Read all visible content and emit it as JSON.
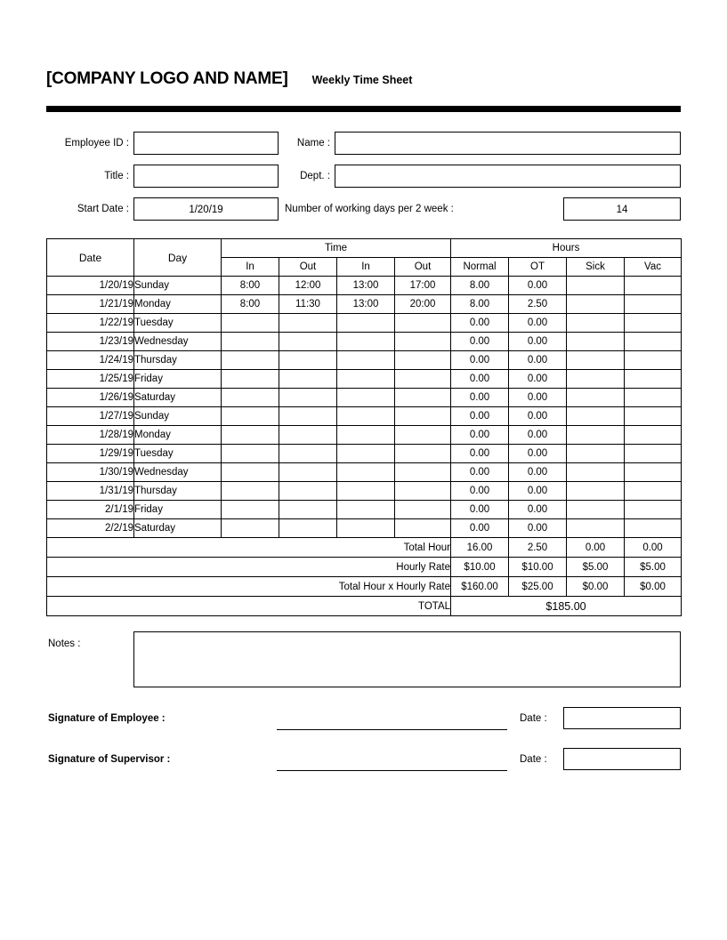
{
  "header": {
    "company": "[COMPANY LOGO AND NAME]",
    "doc_title": "Weekly Time Sheet"
  },
  "form": {
    "employee_id_label": "Employee ID :",
    "employee_id_value": "",
    "name_label": "Name :",
    "name_value": "",
    "title_label": "Title :",
    "title_value": "",
    "dept_label": "Dept. :",
    "dept_value": "",
    "start_date_label": "Start Date :",
    "start_date_value": "1/20/19",
    "working_days_label": "Number of working days per 2 week :",
    "working_days_value": "14"
  },
  "table": {
    "group_headers": {
      "date": "Date",
      "day": "Day",
      "time": "Time",
      "hours": "Hours"
    },
    "sub_headers": {
      "time_in_1": "In",
      "time_out_1": "Out",
      "time_in_2": "In",
      "time_out_2": "Out",
      "normal": "Normal",
      "ot": "OT",
      "sick": "Sick",
      "vac": "Vac"
    },
    "rows": [
      {
        "date": "1/20/19",
        "day": "Sunday",
        "in1": "8:00",
        "out1": "12:00",
        "in2": "13:00",
        "out2": "17:00",
        "normal": "8.00",
        "ot": "0.00",
        "sick": "",
        "vac": ""
      },
      {
        "date": "1/21/19",
        "day": "Monday",
        "in1": "8:00",
        "out1": "11:30",
        "in2": "13:00",
        "out2": "20:00",
        "normal": "8.00",
        "ot": "2.50",
        "sick": "",
        "vac": ""
      },
      {
        "date": "1/22/19",
        "day": "Tuesday",
        "in1": "",
        "out1": "",
        "in2": "",
        "out2": "",
        "normal": "0.00",
        "ot": "0.00",
        "sick": "",
        "vac": ""
      },
      {
        "date": "1/23/19",
        "day": "Wednesday",
        "in1": "",
        "out1": "",
        "in2": "",
        "out2": "",
        "normal": "0.00",
        "ot": "0.00",
        "sick": "",
        "vac": ""
      },
      {
        "date": "1/24/19",
        "day": "Thursday",
        "in1": "",
        "out1": "",
        "in2": "",
        "out2": "",
        "normal": "0.00",
        "ot": "0.00",
        "sick": "",
        "vac": ""
      },
      {
        "date": "1/25/19",
        "day": "Friday",
        "in1": "",
        "out1": "",
        "in2": "",
        "out2": "",
        "normal": "0.00",
        "ot": "0.00",
        "sick": "",
        "vac": ""
      },
      {
        "date": "1/26/19",
        "day": "Saturday",
        "in1": "",
        "out1": "",
        "in2": "",
        "out2": "",
        "normal": "0.00",
        "ot": "0.00",
        "sick": "",
        "vac": ""
      },
      {
        "date": "1/27/19",
        "day": "Sunday",
        "in1": "",
        "out1": "",
        "in2": "",
        "out2": "",
        "normal": "0.00",
        "ot": "0.00",
        "sick": "",
        "vac": ""
      },
      {
        "date": "1/28/19",
        "day": "Monday",
        "in1": "",
        "out1": "",
        "in2": "",
        "out2": "",
        "normal": "0.00",
        "ot": "0.00",
        "sick": "",
        "vac": ""
      },
      {
        "date": "1/29/19",
        "day": "Tuesday",
        "in1": "",
        "out1": "",
        "in2": "",
        "out2": "",
        "normal": "0.00",
        "ot": "0.00",
        "sick": "",
        "vac": ""
      },
      {
        "date": "1/30/19",
        "day": "Wednesday",
        "in1": "",
        "out1": "",
        "in2": "",
        "out2": "",
        "normal": "0.00",
        "ot": "0.00",
        "sick": "",
        "vac": ""
      },
      {
        "date": "1/31/19",
        "day": "Thursday",
        "in1": "",
        "out1": "",
        "in2": "",
        "out2": "",
        "normal": "0.00",
        "ot": "0.00",
        "sick": "",
        "vac": ""
      },
      {
        "date": "2/1/19",
        "day": "Friday",
        "in1": "",
        "out1": "",
        "in2": "",
        "out2": "",
        "normal": "0.00",
        "ot": "0.00",
        "sick": "",
        "vac": ""
      },
      {
        "date": "2/2/19",
        "day": "Saturday",
        "in1": "",
        "out1": "",
        "in2": "",
        "out2": "",
        "normal": "0.00",
        "ot": "0.00",
        "sick": "",
        "vac": ""
      }
    ],
    "summary": {
      "total_hour_label": "Total Hour",
      "total_hour": {
        "normal": "16.00",
        "ot": "2.50",
        "sick": "0.00",
        "vac": "0.00"
      },
      "hourly_rate_label": "Hourly Rate",
      "hourly_rate": {
        "normal": "$10.00",
        "ot": "$10.00",
        "sick": "$5.00",
        "vac": "$5.00"
      },
      "product_label": "Total Hour x Hourly Rate",
      "product": {
        "normal": "$160.00",
        "ot": "$25.00",
        "sick": "$0.00",
        "vac": "$0.00"
      },
      "total_label": "TOTAL",
      "total_value": "$185.00"
    }
  },
  "notes": {
    "label": "Notes :",
    "value": ""
  },
  "signatures": {
    "employee_label": "Signature of Employee :",
    "employee_value": "",
    "employee_date_label": "Date :",
    "employee_date_value": "",
    "supervisor_label": "Signature of Supervisor :",
    "supervisor_value": "",
    "supervisor_date_label": "Date :",
    "supervisor_date_value": ""
  },
  "colors": {
    "summary_gray": "#969696",
    "total_gray": "#808080",
    "rule": "#000000"
  }
}
